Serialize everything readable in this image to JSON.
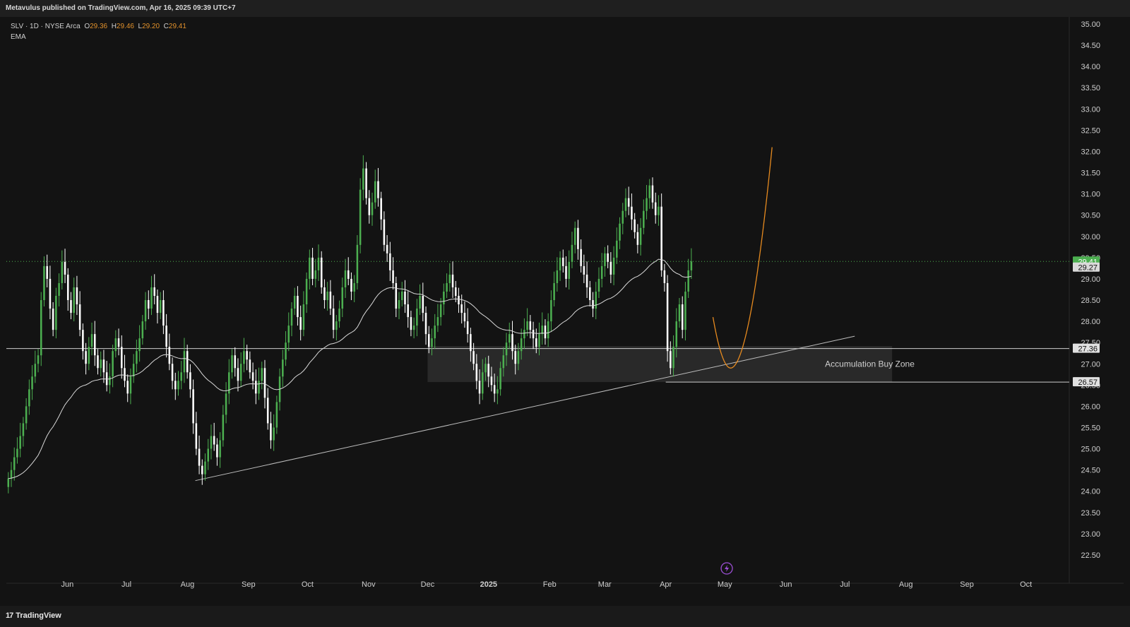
{
  "header": {
    "published_text": "Metavulus published on TradingView.com, Apr 16, 2025 09:39 UTC+7"
  },
  "legend": {
    "symbol": "SLV · 1D · NYSE Arca",
    "open_label": "O",
    "open": "29.36",
    "high_label": "H",
    "high": "29.46",
    "low_label": "L",
    "low": "29.20",
    "close_label": "C",
    "close": "29.41",
    "indicator": "EMA"
  },
  "footer": {
    "brand": "TradingView",
    "logo": "17"
  },
  "colors": {
    "background": "#131313",
    "up_candle": "#4caf50",
    "down_candle": "#ffffff",
    "ema_line": "#d9d9d9",
    "projection": "#e68a1f",
    "zone_fill": "#2e2e2e",
    "price_badge": "#4caf50",
    "level_badge": "#e0e0e0"
  },
  "chart_data": {
    "type": "candlestick",
    "symbol": "SLV",
    "timeframe": "1D",
    "exchange": "NYSE Arca",
    "ylim": [
      22.2,
      35.1
    ],
    "yticks": [
      "35.00",
      "34.50",
      "34.00",
      "33.50",
      "33.00",
      "32.50",
      "32.00",
      "31.50",
      "31.00",
      "30.50",
      "30.00",
      "29.50",
      "29.00",
      "28.50",
      "28.00",
      "27.50",
      "27.00",
      "26.50",
      "26.00",
      "25.50",
      "25.00",
      "24.50",
      "24.00",
      "23.50",
      "23.00",
      "22.50"
    ],
    "xticks": [
      {
        "label": "Jun",
        "day": -319
      },
      {
        "label": "Jul",
        "day": -289
      },
      {
        "label": "Aug",
        "day": -258
      },
      {
        "label": "Sep",
        "day": -227
      },
      {
        "label": "Oct",
        "day": -197
      },
      {
        "label": "Nov",
        "day": -166
      },
      {
        "label": "Dec",
        "day": -136
      },
      {
        "label": "2025",
        "day": -105
      },
      {
        "label": "Feb",
        "day": -74
      },
      {
        "label": "Mar",
        "day": -46
      },
      {
        "label": "Apr",
        "day": -15
      },
      {
        "label": "May",
        "day": 15
      },
      {
        "label": "Jun",
        "day": 46
      },
      {
        "label": "Jul",
        "day": 76
      },
      {
        "label": "Aug",
        "day": 107
      },
      {
        "label": "Sep",
        "day": 138
      },
      {
        "label": "Oct",
        "day": 168
      }
    ],
    "x_domain_days": [
      -350,
      190
    ],
    "series": [
      {
        "closes": [
          24.3,
          24.5,
          24.8,
          25.0,
          25.3,
          25.6,
          26.0,
          26.4,
          26.7,
          27.0,
          27.2,
          28.5,
          29.3,
          29.0,
          28.3,
          27.8,
          28.6,
          28.9,
          29.4,
          29.1,
          28.5,
          28.2,
          28.8,
          28.4,
          27.8,
          27.3,
          27.0,
          27.4,
          27.7,
          27.2,
          26.9,
          27.1,
          26.8,
          26.5,
          26.7,
          27.3,
          27.6,
          27.4,
          26.9,
          26.6,
          26.3,
          26.7,
          27.0,
          27.3,
          27.6,
          28.0,
          28.5,
          28.3,
          28.8,
          28.6,
          28.2,
          28.5,
          27.9,
          27.4,
          27.0,
          26.6,
          26.4,
          26.6,
          26.8,
          27.3,
          26.8,
          26.4,
          25.6,
          25.0,
          24.6,
          24.4,
          24.7,
          25.0,
          25.3,
          25.1,
          24.8,
          25.2,
          25.8,
          26.3,
          26.8,
          27.2,
          26.9,
          26.6,
          27.0,
          27.3,
          27.1,
          26.8,
          26.6,
          26.3,
          26.6,
          26.9,
          26.2,
          25.6,
          25.2,
          25.5,
          26.1,
          26.7,
          27.1,
          27.5,
          27.9,
          28.3,
          28.6,
          28.1,
          27.8,
          28.4,
          29.0,
          29.5,
          29.0,
          29.2,
          29.5,
          28.8,
          28.5,
          28.7,
          28.3,
          27.8,
          28.0,
          28.3,
          28.8,
          29.2,
          29.0,
          28.7,
          28.9,
          29.8,
          31.1,
          31.6,
          30.9,
          30.5,
          30.8,
          31.3,
          30.9,
          30.4,
          29.8,
          29.6,
          29.2,
          28.9,
          28.3,
          28.5,
          28.7,
          28.4,
          28.1,
          27.8,
          27.9,
          28.3,
          28.6,
          28.2,
          27.7,
          27.4,
          27.6,
          27.9,
          28.1,
          28.4,
          28.7,
          28.9,
          29.1,
          28.8,
          28.6,
          28.4,
          28.2,
          28.0,
          27.7,
          27.3,
          27.0,
          26.6,
          26.3,
          26.8,
          27.0,
          26.7,
          26.5,
          26.3,
          26.4,
          26.9,
          27.2,
          27.5,
          27.7,
          27.3,
          27.0,
          27.3,
          27.6,
          27.8,
          28.0,
          27.8,
          27.6,
          27.4,
          27.7,
          27.9,
          27.6,
          28.0,
          28.5,
          28.9,
          29.2,
          29.5,
          29.3,
          29.0,
          29.4,
          29.8,
          30.2,
          29.7,
          29.3,
          29.1,
          28.8,
          28.5,
          28.3,
          28.7,
          29.0,
          29.3,
          29.6,
          29.4,
          29.1,
          29.5,
          29.9,
          30.3,
          30.6,
          30.9,
          30.7,
          30.4,
          30.1,
          29.8,
          30.2,
          30.6,
          30.9,
          31.2,
          30.8,
          30.5,
          30.7,
          29.2,
          28.9,
          27.3,
          26.9,
          27.4,
          28.0,
          28.4,
          27.8,
          28.7,
          29.2,
          29.41
        ],
        "ema_period": 50
      }
    ],
    "levels": [
      {
        "value": 27.36,
        "label": "27.36",
        "style": "solid"
      },
      {
        "value": 26.57,
        "label": "26.57",
        "style": "solid"
      },
      {
        "value": 29.41,
        "label": "29.41",
        "style": "dotted",
        "current": true
      },
      {
        "value": 29.27,
        "label": "29.27",
        "style": "ema"
      }
    ],
    "zone": {
      "label": "Accumulation Buy Zone",
      "top": 27.42,
      "bottom": 26.57,
      "from_day": -136,
      "to_day": 100
    },
    "trendline": {
      "from": {
        "day": -254,
        "price": 24.25
      },
      "to": {
        "day": 81,
        "price": 27.65
      }
    },
    "projection": {
      "from_day": 9,
      "to_day": 39,
      "start": 28.1,
      "low": 26.9,
      "end": 32.1
    },
    "annotations": [
      "Accumulation Buy Zone"
    ]
  }
}
